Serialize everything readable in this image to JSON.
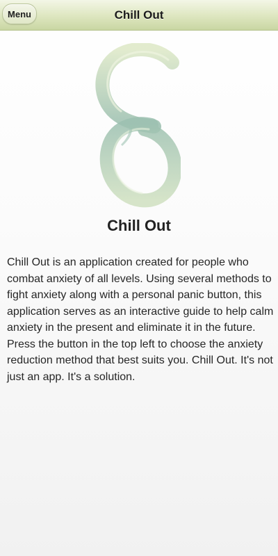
{
  "header": {
    "menu_label": "Menu",
    "title": "Chill Out"
  },
  "logo": {
    "icon": "ensō-double-circle-icon",
    "color_light": "#dfe9c8",
    "color_dark": "#8fb6a6"
  },
  "main": {
    "heading": "Chill Out",
    "description": "Chill Out is an application created for people who combat anxiety of all levels. Using several methods to fight anxiety along with a personal panic button, this application serves as an interactive guide to help calm anxiety in the present and eliminate it in the future. Press the button in the top left to choose the anxiety reduction method that best suits you. Chill Out. It's not just an app. It's a solution."
  }
}
